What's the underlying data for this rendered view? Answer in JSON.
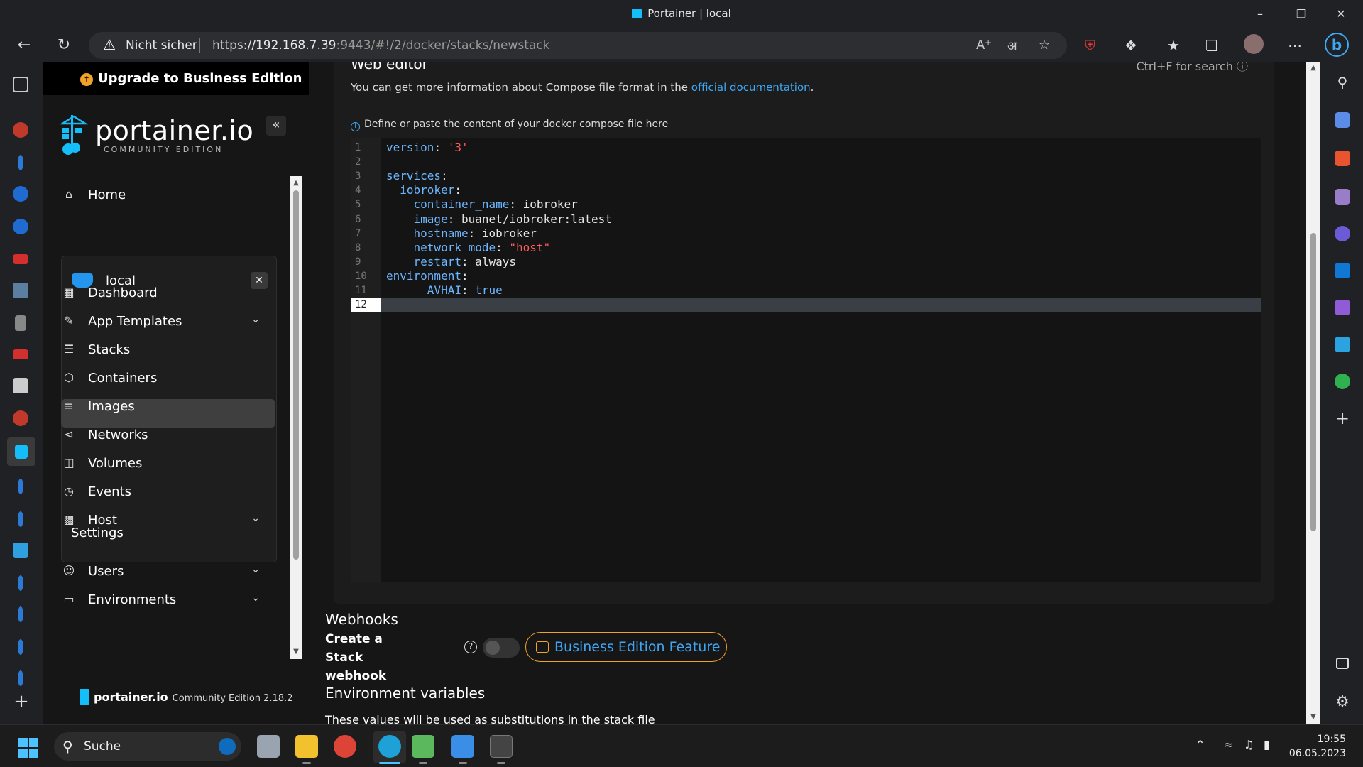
{
  "browser": {
    "tab_title": "Portainer | local",
    "not_secure": "Nicht sicher",
    "url_scheme": "https",
    "url_host": "://192.168.7.39",
    "url_rest": ":9443/#!/2/docker/stacks/newstack"
  },
  "sidebar": {
    "upgrade_label": "Upgrade to Business Edition",
    "logo_name": "portainer.io",
    "logo_edition": "COMMUNITY EDITION",
    "home": "Home",
    "env_name": "local",
    "env_items": [
      {
        "label": "Dashboard"
      },
      {
        "label": "App Templates"
      },
      {
        "label": "Stacks"
      },
      {
        "label": "Containers"
      },
      {
        "label": "Images"
      },
      {
        "label": "Networks"
      },
      {
        "label": "Volumes"
      },
      {
        "label": "Events"
      },
      {
        "label": "Host"
      }
    ],
    "settings_title": "Settings",
    "settings_items": [
      {
        "label": "Users"
      },
      {
        "label": "Environments"
      }
    ],
    "footer_brand": "portainer.io",
    "footer_edition": "Community Edition 2.18.2"
  },
  "editor": {
    "title": "Web editor",
    "search_hint": "Ctrl+F for search",
    "info_prefix": "You can get more information about Compose file format in the",
    "info_link": "official documentation",
    "info_suffix": ".",
    "hint": "Define or paste the content of your docker compose file here",
    "lines": [
      {
        "num": "1",
        "key": "version",
        "sep": ": ",
        "val": "'3'",
        "type": "str",
        "indent": ""
      },
      {
        "num": "2",
        "key": "",
        "sep": "",
        "val": "",
        "type": "",
        "indent": ""
      },
      {
        "num": "3",
        "key": "services",
        "sep": ":",
        "val": "",
        "type": "",
        "indent": ""
      },
      {
        "num": "4",
        "key": "iobroker",
        "sep": ":",
        "val": "",
        "type": "",
        "indent": "  "
      },
      {
        "num": "5",
        "key": "container_name",
        "sep": ": ",
        "val": "iobroker",
        "type": "plain",
        "indent": "    "
      },
      {
        "num": "6",
        "key": "image",
        "sep": ": ",
        "val": "buanet/iobroker:latest",
        "type": "plain",
        "indent": "    "
      },
      {
        "num": "7",
        "key": "hostname",
        "sep": ": ",
        "val": "iobroker",
        "type": "plain",
        "indent": "    "
      },
      {
        "num": "8",
        "key": "network_mode",
        "sep": ": ",
        "val": "\"host\"",
        "type": "str",
        "indent": "    "
      },
      {
        "num": "9",
        "key": "restart",
        "sep": ": ",
        "val": "always",
        "type": "plain",
        "indent": "    "
      },
      {
        "num": "10",
        "key": "environment",
        "sep": ":",
        "val": "",
        "type": "",
        "indent": ""
      },
      {
        "num": "11",
        "key": "AVHAI",
        "sep": ": ",
        "val": "true",
        "type": "bool",
        "indent": "      "
      },
      {
        "num": "12",
        "key": "",
        "sep": "",
        "val": "",
        "type": "",
        "indent": ""
      }
    ]
  },
  "webhooks": {
    "title": "Webhooks",
    "create_label": "Create a Stack webhook",
    "help": "?",
    "be_feature": "Business Edition Feature"
  },
  "env_vars": {
    "title": "Environment variables",
    "desc": "These values will be used as substitutions in the stack file"
  },
  "taskbar": {
    "search": "Suche",
    "time": "19:55",
    "date": "06.05.2023"
  },
  "colors": {
    "accent_blue": "#3ea7f5",
    "warning_orange": "#f0a229",
    "docker_blue": "#2496ed"
  }
}
